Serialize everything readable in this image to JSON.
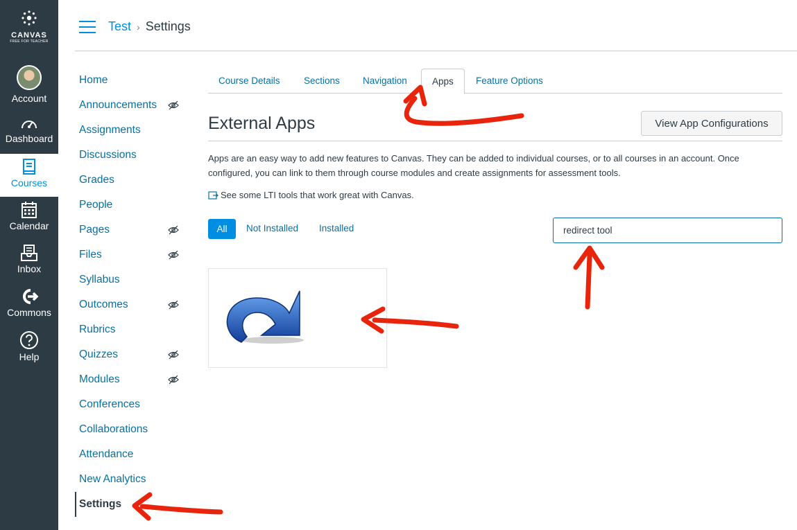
{
  "global_nav": {
    "logo_word": "CANVAS",
    "logo_sub": "FREE FOR TEACHER",
    "items": [
      {
        "label": "Account",
        "icon": "avatar"
      },
      {
        "label": "Dashboard",
        "icon": "dashboard-icon"
      },
      {
        "label": "Courses",
        "icon": "courses-icon"
      },
      {
        "label": "Calendar",
        "icon": "calendar-icon"
      },
      {
        "label": "Inbox",
        "icon": "inbox-icon"
      },
      {
        "label": "Commons",
        "icon": "commons-icon"
      },
      {
        "label": "Help",
        "icon": "help-icon"
      }
    ],
    "active": "Courses"
  },
  "breadcrumb": {
    "course": "Test",
    "separator": "›",
    "current": "Settings"
  },
  "course_nav": {
    "items": [
      {
        "label": "Home",
        "hidden": false
      },
      {
        "label": "Announcements",
        "hidden": true
      },
      {
        "label": "Assignments",
        "hidden": false
      },
      {
        "label": "Discussions",
        "hidden": false
      },
      {
        "label": "Grades",
        "hidden": false
      },
      {
        "label": "People",
        "hidden": false
      },
      {
        "label": "Pages",
        "hidden": true
      },
      {
        "label": "Files",
        "hidden": true
      },
      {
        "label": "Syllabus",
        "hidden": false
      },
      {
        "label": "Outcomes",
        "hidden": true
      },
      {
        "label": "Rubrics",
        "hidden": false
      },
      {
        "label": "Quizzes",
        "hidden": true
      },
      {
        "label": "Modules",
        "hidden": true
      },
      {
        "label": "Conferences",
        "hidden": false
      },
      {
        "label": "Collaborations",
        "hidden": false
      },
      {
        "label": "Attendance",
        "hidden": false
      },
      {
        "label": "New Analytics",
        "hidden": false
      },
      {
        "label": "Settings",
        "hidden": false
      }
    ],
    "active": "Settings"
  },
  "tabs": [
    "Course Details",
    "Sections",
    "Navigation",
    "Apps",
    "Feature Options"
  ],
  "active_tab": "Apps",
  "external_apps": {
    "heading": "External Apps",
    "config_button": "View App Configurations",
    "description": "Apps are an easy way to add new features to Canvas. They can be added to individual courses, or to all courses in an account. Once configured, you can link to them through course modules and create assignments for assessment tools.",
    "lti_link": "See some LTI tools that work great with Canvas.",
    "filters": [
      "All",
      "Not Installed",
      "Installed"
    ],
    "active_filter": "All",
    "search_value": "redirect tool",
    "app_card_icon": "redirect-arrow-icon"
  },
  "colors": {
    "nav_bg": "#2d3b45",
    "link": "#0770a3",
    "brand_blue": "#008ee2",
    "annotation": "#e8250c"
  }
}
